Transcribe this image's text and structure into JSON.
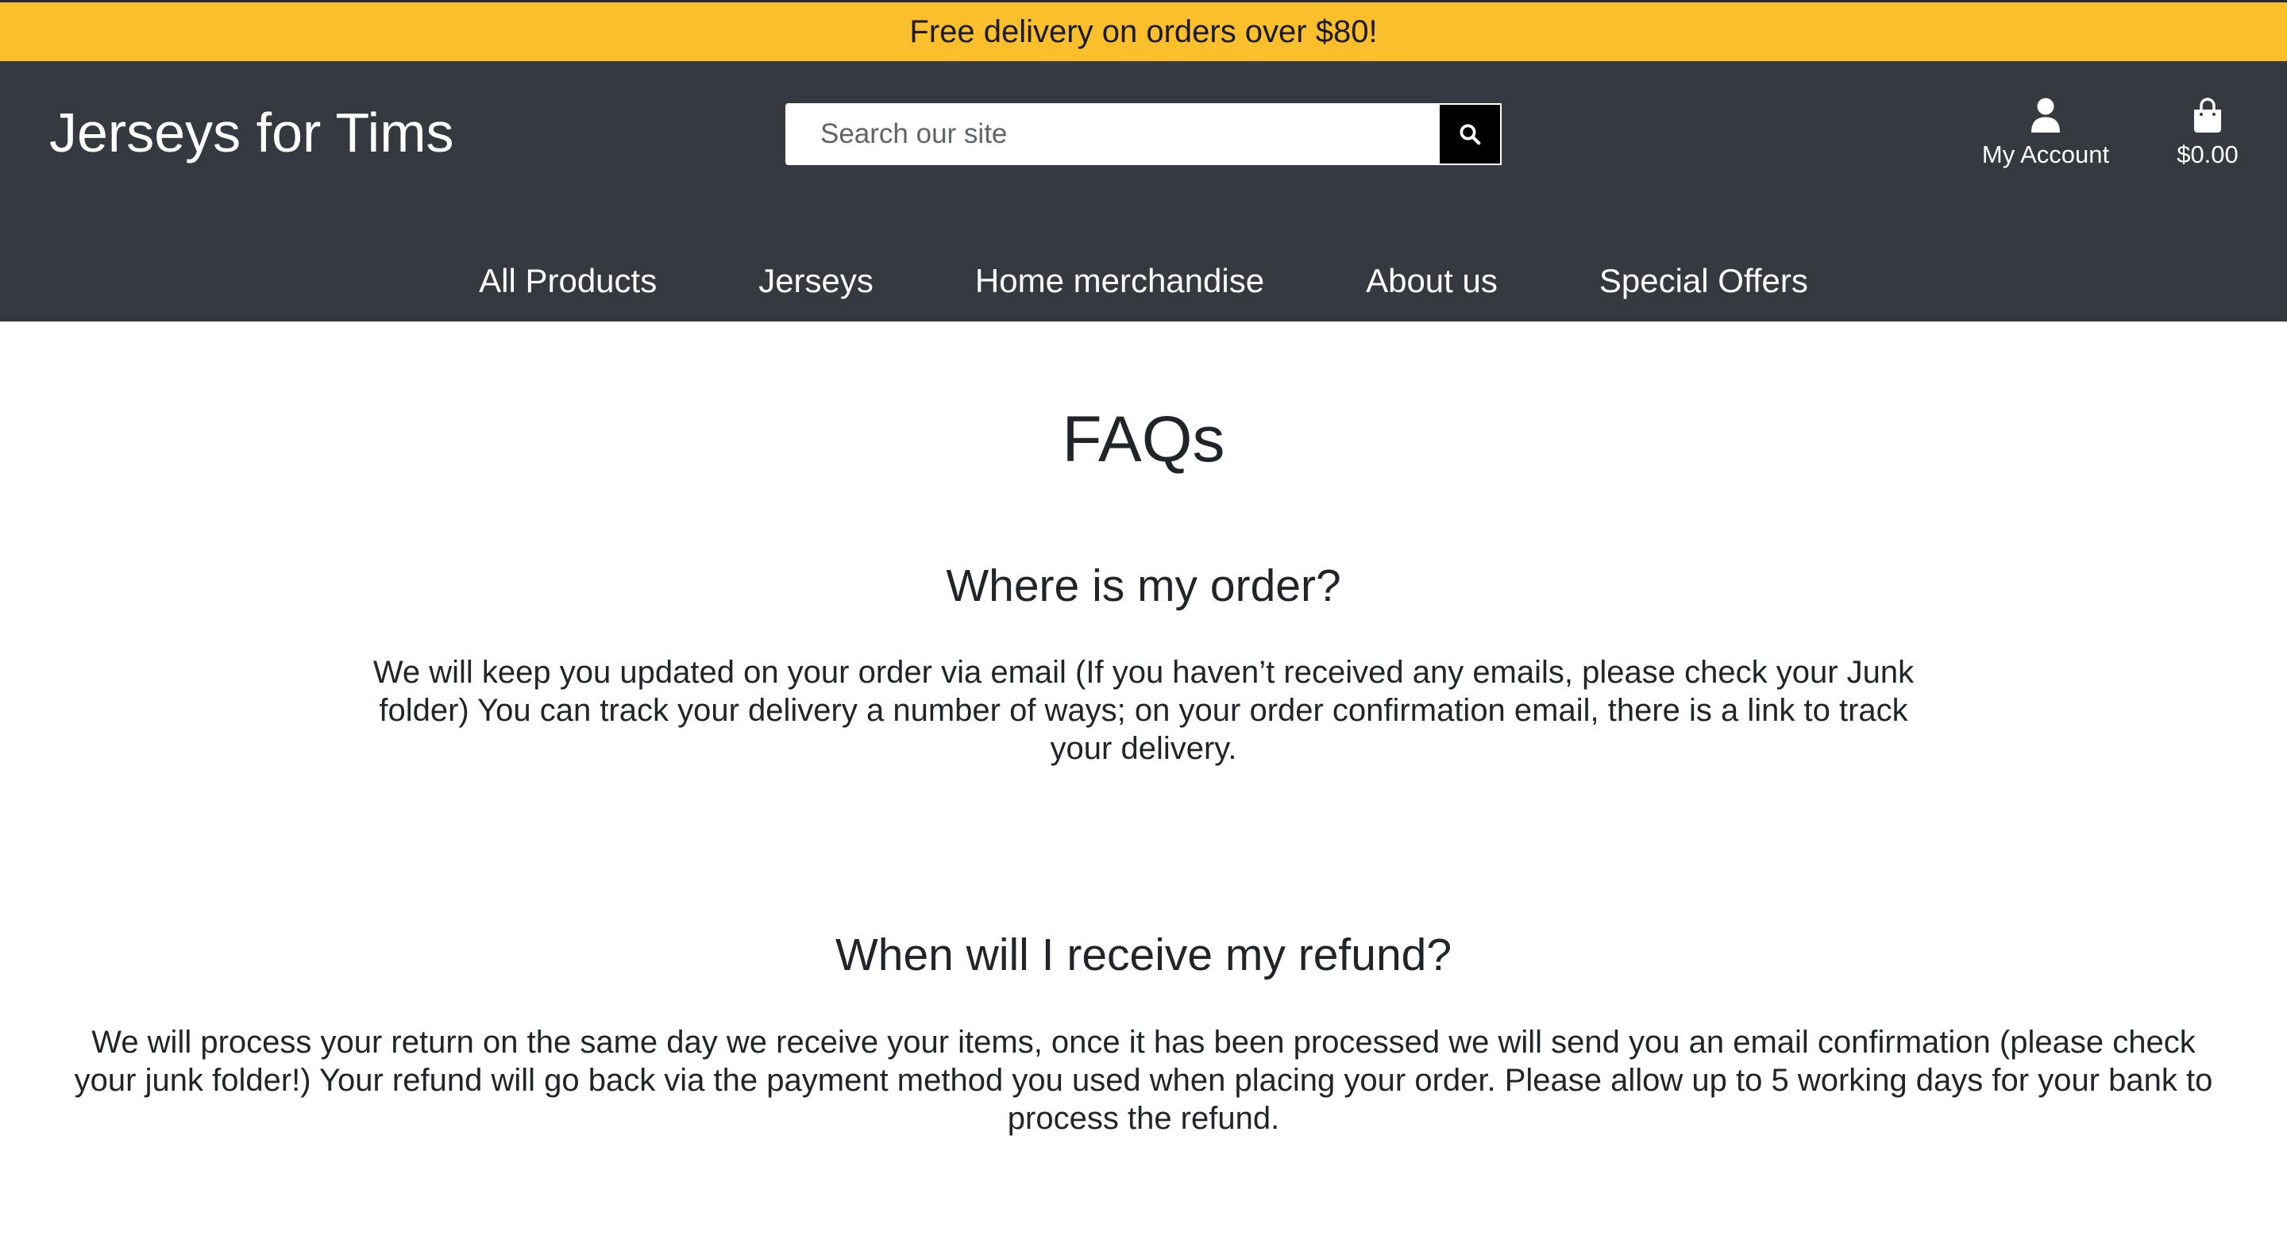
{
  "announcement": {
    "text": "Free delivery on orders over $80!"
  },
  "header": {
    "logo": "Jerseys for Tims",
    "search": {
      "placeholder": "Search our site",
      "value": ""
    },
    "account_label": "My Account",
    "cart_total": "$0.00"
  },
  "nav": {
    "items": [
      {
        "label": "All Products"
      },
      {
        "label": "Jerseys"
      },
      {
        "label": "Home merchandise"
      },
      {
        "label": "About us"
      },
      {
        "label": "Special Offers"
      }
    ]
  },
  "main": {
    "title": "FAQs",
    "faqs": [
      {
        "question": "Where is my order?",
        "answer": "We will keep you updated on your order via email (If you haven’t received any emails, please check your Junk folder) You can track your delivery a number of ways; on your order confirmation email, there is a link to track your delivery."
      },
      {
        "question": "When will I receive my refund?",
        "answer": "We will process your return on the same day we receive your items, once it has been processed we will send you an email confirmation (please check your junk folder!) Your refund will go back via the payment method you used when placing your order. Please allow up to 5 working days for your bank to process the refund."
      }
    ]
  },
  "colors": {
    "announcement_bg": "#fbbf2c",
    "header_bg": "#353a40",
    "search_button_bg": "#000000"
  },
  "icons": {
    "search": "search-icon",
    "account": "user-icon",
    "cart": "shopping-bag-icon"
  }
}
